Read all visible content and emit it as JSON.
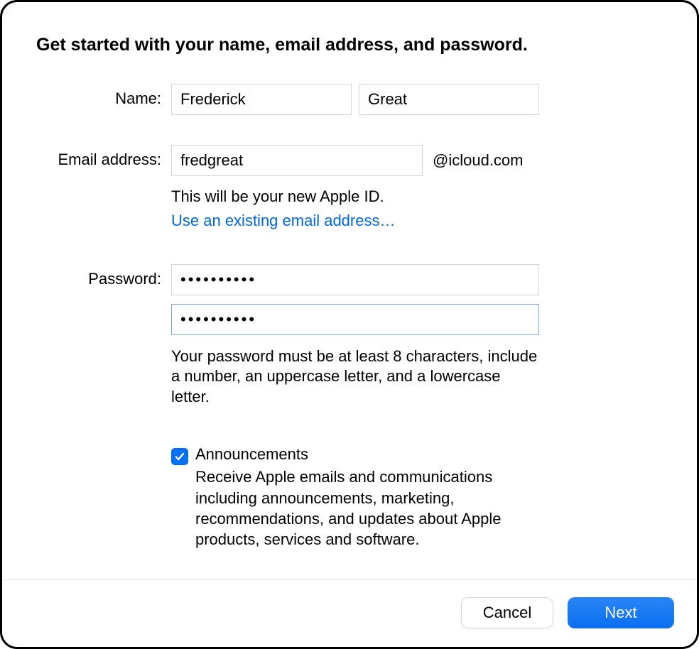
{
  "heading": "Get started with your name, email address, and password.",
  "name": {
    "label": "Name:",
    "first_value": "Frederick",
    "last_value": "Great"
  },
  "email": {
    "label": "Email address:",
    "value": "fredgreat",
    "suffix": "@icloud.com",
    "helper": "This will be your new Apple ID.",
    "link": "Use an existing email address…"
  },
  "password": {
    "label": "Password:",
    "value": "••••••••••",
    "confirm_value": "••••••••••",
    "hint": "Your password must be at least 8 characters, include a number, an uppercase letter, and a lowercase letter."
  },
  "announcements": {
    "checked": true,
    "label": "Announcements",
    "desc": "Receive Apple emails and communications including announcements, marketing, recommendations, and updates about Apple products, services and software."
  },
  "buttons": {
    "cancel": "Cancel",
    "next": "Next"
  }
}
